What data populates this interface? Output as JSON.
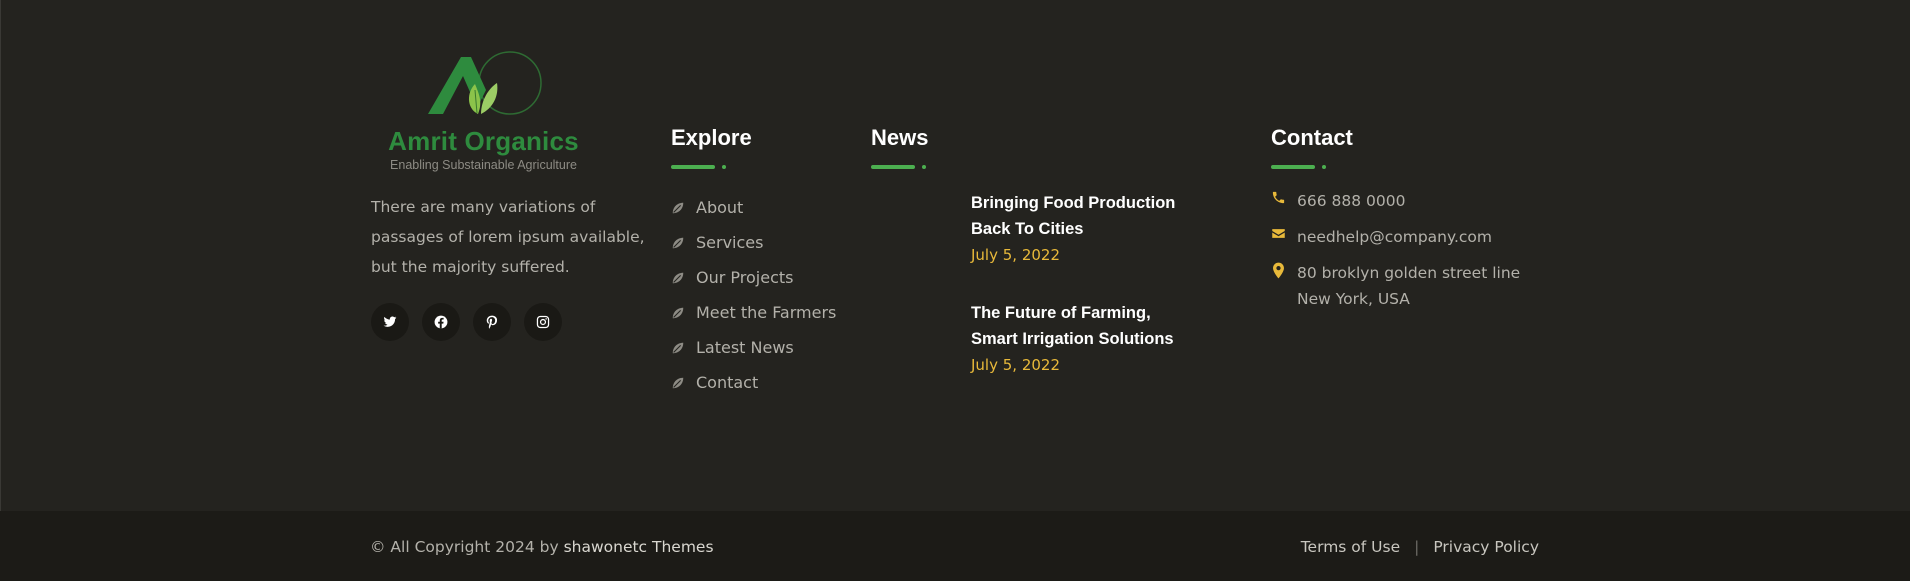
{
  "brand": {
    "name": "Amrit Organics",
    "tagline": "Enabling Substainable Agriculture",
    "colors": {
      "primary_green": "#2e8b3e",
      "accent_green": "#4caf50",
      "date_yellow": "#e8b93a"
    }
  },
  "about": {
    "text": "There are many variations of passages of lorem ipsum available, but the majority suffered.",
    "socials": [
      {
        "icon": "twitter-icon"
      },
      {
        "icon": "facebook-icon"
      },
      {
        "icon": "pinterest-icon"
      },
      {
        "icon": "instagram-icon"
      }
    ]
  },
  "explore": {
    "title": "Explore",
    "items": [
      "About",
      "Services",
      "Our Projects",
      "Meet the Farmers",
      "Latest News",
      "Contact"
    ]
  },
  "news": {
    "title": "News",
    "items": [
      {
        "title_line1": "Bringing Food Production",
        "title_line2": "Back To Cities",
        "date": "July 5, 2022"
      },
      {
        "title_line1": "The Future of Farming,",
        "title_line2": "Smart Irrigation Solutions",
        "date": "July 5, 2022"
      }
    ]
  },
  "contact": {
    "title": "Contact",
    "phone": "666 888 0000",
    "email": "needhelp@company.com",
    "address_line1": "80 broklyn golden street line",
    "address_line2": "New York, USA"
  },
  "bottom": {
    "copyright_prefix": "© All Copyright 2024 by",
    "copyright_brand": "shawonetc Themes",
    "terms": "Terms of Use",
    "separator": "|",
    "privacy": "Privacy Policy"
  }
}
